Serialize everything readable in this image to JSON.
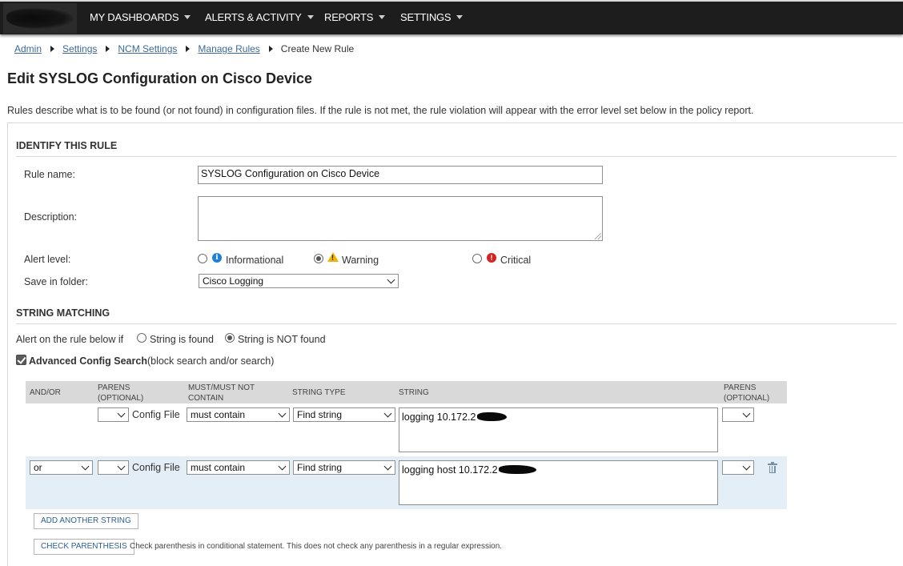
{
  "nav": {
    "items": [
      {
        "label": "MY DASHBOARDS"
      },
      {
        "label": "ALERTS & ACTIVITY"
      },
      {
        "label": "REPORTS"
      },
      {
        "label": "SETTINGS"
      }
    ]
  },
  "breadcrumb": {
    "links": [
      "Admin",
      "Settings",
      "NCM Settings",
      "Manage Rules"
    ],
    "current": "Create New Rule"
  },
  "page": {
    "title": "Edit SYSLOG Configuration on Cisco Device",
    "intro": "Rules describe what is to be found (or not found) in configuration files. If the rule is not met, the rule violation will appear with the error level set below in the policy report."
  },
  "identify": {
    "section_title": "IDENTIFY THIS RULE",
    "rule_name_label": "Rule name:",
    "rule_name_value": "SYSLOG Configuration on Cisco Device",
    "description_label": "Description:",
    "description_value": "",
    "alert_level_label": "Alert level:",
    "alert_levels": [
      {
        "label": "Informational",
        "icon": "info-icon",
        "checked": false
      },
      {
        "label": "Warning",
        "icon": "warning-icon",
        "checked": true
      },
      {
        "label": "Critical",
        "icon": "critical-icon",
        "checked": false
      }
    ],
    "folder_label": "Save in folder:",
    "folder_value": "Cisco Logging"
  },
  "matching": {
    "section_title": "STRING MATCHING",
    "alert_if_label": "Alert on the rule below if",
    "option_found": "String is found",
    "option_not_found": "String is NOT found",
    "not_found_checked": true,
    "advanced_label": "Advanced Config Search",
    "advanced_hint": "(block search and/or search)",
    "advanced_checked": true
  },
  "table": {
    "headers": {
      "and_or": "AND/OR",
      "parens_open_1": "PARENS",
      "parens_open_2": "(OPTIONAL)",
      "must_1": "MUST/MUST NOT",
      "must_2": "CONTAIN",
      "string_type": "STRING TYPE",
      "string": "STRING",
      "parens_close_1": "PARENS",
      "parens_close_2": "(OPTIONAL)"
    },
    "rows": [
      {
        "and_or": "",
        "parens_open": "",
        "source": "Config File",
        "must": "must contain",
        "string_type": "Find string",
        "string": "logging 10.172.2",
        "parens_close": ""
      },
      {
        "and_or": "or",
        "parens_open": "",
        "source": "Config File",
        "must": "must contain",
        "string_type": "Find string",
        "string": "logging host 10.172.2",
        "parens_close": ""
      }
    ]
  },
  "actions": {
    "add_string": "ADD ANOTHER STRING",
    "check_parens": "CHECK PARENTHESIS",
    "check_parens_help": "Check parenthesis in conditional statement. This does not check any parenthesis in a regular expression."
  }
}
